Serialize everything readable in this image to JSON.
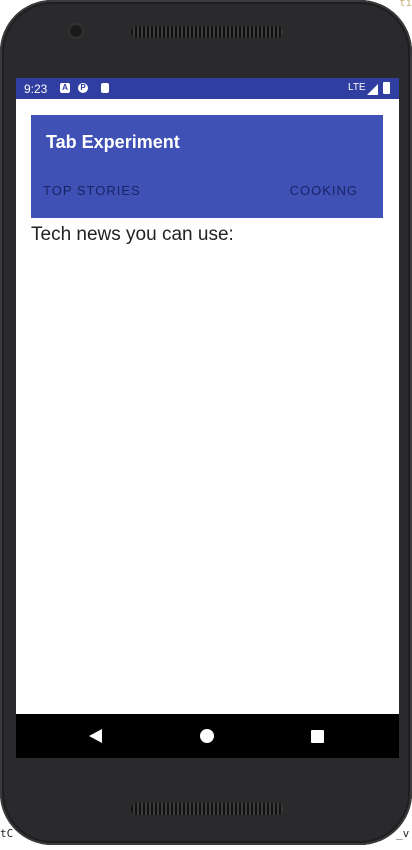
{
  "status_bar": {
    "time": "9:23",
    "notification_icons": [
      "a-icon",
      "p-icon",
      "sd-card-icon"
    ],
    "network": "LTE",
    "signal_icon": "signal-icon",
    "battery_icon": "battery-icon"
  },
  "app_bar": {
    "title": "Tab Experiment",
    "tabs": [
      {
        "label": "TOP STORIES"
      },
      {
        "label": "COOKING"
      }
    ]
  },
  "content": {
    "text": "Tech news you can use:"
  },
  "nav_bar": {
    "back_icon": "back-icon",
    "home_icon": "home-icon",
    "recents_icon": "recents-icon"
  },
  "edge_text": {
    "top_right": "ti",
    "bottom_left": "tC",
    "bottom_right": "_v"
  },
  "colors": {
    "status_bar": "#2f3ea0",
    "app_bar": "#3f51b5",
    "tab_text": "#1a2366",
    "nav_bar": "#000000"
  }
}
